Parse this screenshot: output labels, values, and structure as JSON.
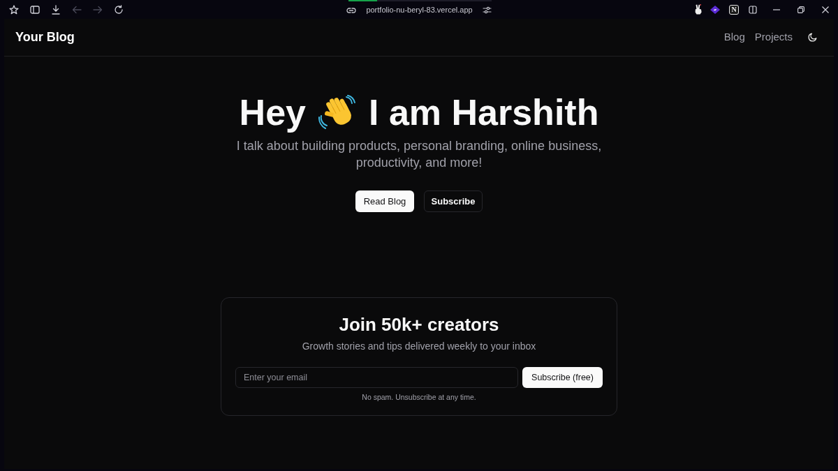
{
  "browser": {
    "loading": {
      "level": 0.2
    },
    "nav": [
      {
        "kind": "back",
        "disabled": true
      },
      {
        "kind": "forward",
        "disabled": true
      }
    ],
    "address": "portfolio-nu-beryl-83.vercel.app",
    "extension_badge": "N"
  },
  "header": {
    "brand": "Your Blog",
    "links": [
      "Blog",
      "Projects"
    ]
  },
  "hero": {
    "greeting": "Hey",
    "name_line": "I am Harshith",
    "subtitle": "I talk about building products, personal branding, online business, productivity, and more!",
    "buttons": [
      {
        "label": "Read Blog",
        "kind": "primary"
      },
      {
        "label": "Subscribe",
        "kind": "outline"
      }
    ]
  },
  "newsletter": {
    "title": "Join 50k+ creators",
    "subtitle": "Growth stories and tips delivered weekly to your inbox",
    "email": {
      "placeholder": "Enter your email"
    },
    "button": "Subscribe (free)",
    "note": "No spam. Unsubscribe at any time."
  }
}
